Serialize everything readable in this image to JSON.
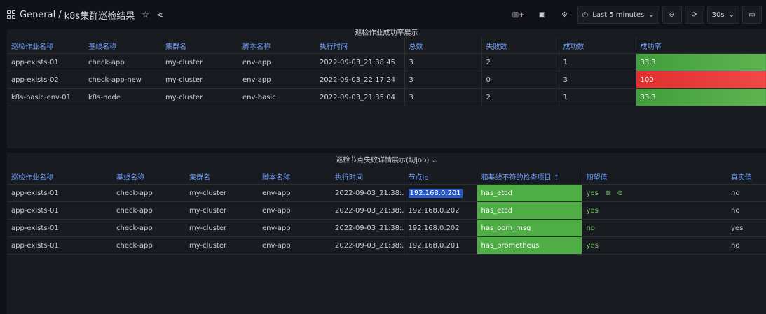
{
  "breadcrumb": {
    "folder": "General",
    "separator": "/",
    "dashboard": "k8s集群巡检结果"
  },
  "toolbar": {
    "time_range": "Last 5 minutes",
    "refresh": "30s"
  },
  "panel1": {
    "title": "巡检作业成功率展示",
    "headers": [
      "巡检作业名称",
      "基线名称",
      "集群名",
      "脚本名称",
      "执行时间",
      "总数",
      "失败数",
      "成功数",
      "成功率"
    ],
    "rows": [
      [
        "app-exists-01",
        "check-app",
        "my-cluster",
        "env-app",
        "2022-09-03_21:38:45",
        "3",
        "2",
        "1",
        "33.3"
      ],
      [
        "app-exists-02",
        "check-app-new",
        "my-cluster",
        "env-app",
        "2022-09-03_22:17:24",
        "3",
        "0",
        "3",
        "100"
      ],
      [
        "k8s-basic-env-01",
        "k8s-node",
        "my-cluster",
        "env-basic",
        "2022-09-03_21:35:04",
        "3",
        "2",
        "1",
        "33.3"
      ]
    ]
  },
  "panel2": {
    "title": "巡检节点失败详情展示(切job)",
    "headers": [
      "巡检作业名称",
      "基线名称",
      "集群名",
      "脚本名称",
      "执行时间",
      "节点ip",
      "和基线不符的检查项目 ↑",
      "期望值",
      "真实值"
    ],
    "rows": [
      [
        "app-exists-01",
        "check-app",
        "my-cluster",
        "env-app",
        "2022-09-03_21:38:...",
        "192.168.0.201",
        "has_etcd",
        "yes",
        "no"
      ],
      [
        "app-exists-01",
        "check-app",
        "my-cluster",
        "env-app",
        "2022-09-03_21:38:...",
        "192.168.0.202",
        "has_etcd",
        "yes",
        "no"
      ],
      [
        "app-exists-01",
        "check-app",
        "my-cluster",
        "env-app",
        "2022-09-03_21:38:...",
        "192.168.0.202",
        "has_oom_msg",
        "no",
        "yes"
      ],
      [
        "app-exists-01",
        "check-app",
        "my-cluster",
        "env-app",
        "2022-09-03_21:38:...",
        "192.168.0.201",
        "has_prometheus",
        "yes",
        "no"
      ]
    ]
  }
}
